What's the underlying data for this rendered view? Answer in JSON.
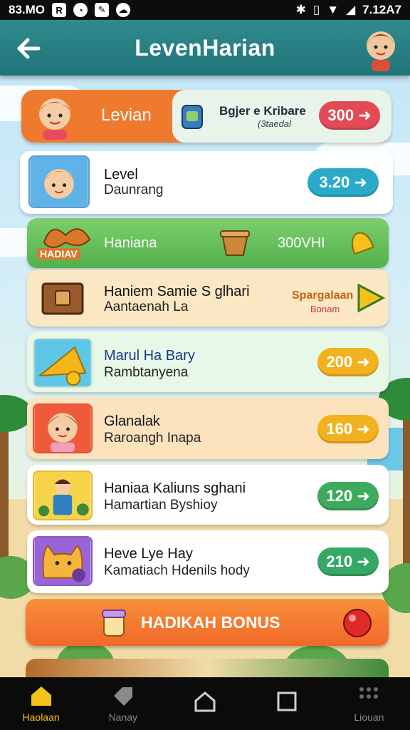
{
  "status_bar": {
    "time": "83.MO",
    "right_text": "7.12A7"
  },
  "header": {
    "title": "LevenHarian"
  },
  "banner": {
    "label": "Levian",
    "card_title": "Bgjer e Kribare",
    "card_subtitle": "(3taedal",
    "reward": "300"
  },
  "missions": [
    {
      "title": "Level",
      "subtitle": "Daunrang",
      "reward": "3.20",
      "color": "#2aaac8"
    },
    {
      "title": "Haniana",
      "subtitle": "",
      "reward": "300VHI",
      "color": "#5cb85c",
      "tag": "HADIAV"
    },
    {
      "title": "Haniem Samie S glhari",
      "subtitle": "Aantaenah La",
      "reward_label": "Spargalaan",
      "reward_sub": "Bonam"
    },
    {
      "title": "Marul Ha Bary",
      "subtitle": "Rambtanyena",
      "reward": "200",
      "color": "#f2b21f"
    },
    {
      "title": "Glanalak",
      "subtitle": "Raroangh Inapa",
      "reward": "160",
      "color": "#f2b21f"
    },
    {
      "title": "Haniaa Kaliuns sghani",
      "subtitle": "Hamartian Byshioy",
      "reward": "120",
      "color": "#3eaa5e"
    },
    {
      "title": "Heve Lye Hay",
      "subtitle": "Kamatiach Hdenils hody",
      "reward": "210",
      "color": "#35a866"
    }
  ],
  "bonus": {
    "label": "HADIKAH BONUS"
  },
  "bottom_nav": [
    {
      "label": "Haolaan",
      "icon": "home-filled-icon",
      "active": true
    },
    {
      "label": "Nanay",
      "icon": "tag-icon",
      "active": false
    },
    {
      "label": "",
      "icon": "home-outline-icon",
      "active": false
    },
    {
      "label": "",
      "icon": "square-icon",
      "active": false
    },
    {
      "label": "Liouan",
      "icon": "grid-dots-icon",
      "active": false
    }
  ],
  "colors": {
    "header": "#21757a",
    "banner_orange": "#ef7a2e",
    "reward_red": "#e24a55",
    "accent_yellow": "#f5c21b"
  }
}
